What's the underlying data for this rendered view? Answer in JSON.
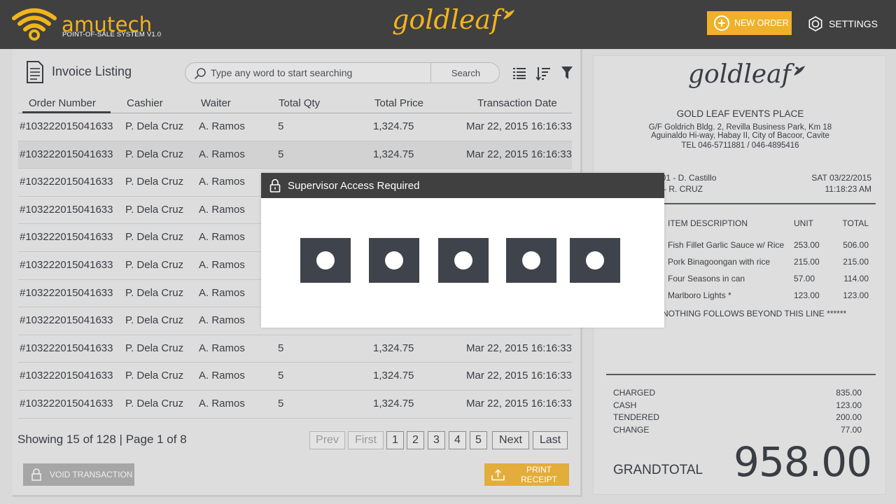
{
  "header": {
    "brand_name": "amutech",
    "brand_sub": "POINT-OF-SALE SYSTEM V1.0",
    "logo_text": "goldleaf",
    "new_order_label": "NEW ORDER",
    "settings_label": "SETTINGS",
    "accent": "#f2b41c"
  },
  "invoice": {
    "title": "Invoice Listing",
    "search_placeholder": "Type any word to start searching",
    "search_button": "Search",
    "columns": [
      "Order Number",
      "Cashier",
      "Waiter",
      "Total Qty",
      "Total Price",
      "Transaction Date"
    ],
    "rows": [
      {
        "order": "#103222015041633",
        "cashier": "P. Dela Cruz",
        "waiter": "A. Ramos",
        "qty": "5",
        "price": "1,324.75",
        "date": "Mar 22, 2015 16:16:33"
      },
      {
        "order": "#103222015041633",
        "cashier": "P. Dela Cruz",
        "waiter": "A. Ramos",
        "qty": "5",
        "price": "1,324.75",
        "date": "Mar 22, 2015 16:16:33"
      },
      {
        "order": "#103222015041633",
        "cashier": "P. Dela Cruz",
        "waiter": "A. Ramos",
        "qty": "",
        "price": "",
        "date": ""
      },
      {
        "order": "#103222015041633",
        "cashier": "P. Dela Cruz",
        "waiter": "A. Ramos",
        "qty": "",
        "price": "",
        "date": ""
      },
      {
        "order": "#103222015041633",
        "cashier": "P. Dela Cruz",
        "waiter": "A. Ramos",
        "qty": "",
        "price": "",
        "date": ""
      },
      {
        "order": "#103222015041633",
        "cashier": "P. Dela Cruz",
        "waiter": "A. Ramos",
        "qty": "",
        "price": "",
        "date": ""
      },
      {
        "order": "#103222015041633",
        "cashier": "P. Dela Cruz",
        "waiter": "A. Ramos",
        "qty": "",
        "price": "",
        "date": ""
      },
      {
        "order": "#103222015041633",
        "cashier": "P. Dela Cruz",
        "waiter": "A. Ramos",
        "qty": "",
        "price": "",
        "date": ""
      },
      {
        "order": "#103222015041633",
        "cashier": "P. Dela Cruz",
        "waiter": "A. Ramos",
        "qty": "5",
        "price": "1,324.75",
        "date": "Mar 22, 2015 16:16:33"
      },
      {
        "order": "#103222015041633",
        "cashier": "P. Dela Cruz",
        "waiter": "A. Ramos",
        "qty": "5",
        "price": "1,324.75",
        "date": "Mar 22, 2015 16:16:33"
      },
      {
        "order": "#103222015041633",
        "cashier": "P. Dela Cruz",
        "waiter": "A. Ramos",
        "qty": "5",
        "price": "1,324.75",
        "date": "Mar 22, 2015 16:16:33"
      }
    ],
    "showing": "Showing 15 of 128 | Page 1 of 8",
    "pagination": {
      "prev": "Prev",
      "first": "First",
      "pages": [
        "1",
        "2",
        "3",
        "4",
        "5"
      ],
      "next": "Next",
      "last": "Last"
    },
    "void_label": "VOID TRANSACTION",
    "print_label": "PRINT RECEIPT"
  },
  "receipt": {
    "logo_text": "goldleaf",
    "business_name": "GOLD LEAF EVENTS PLACE",
    "address_1": "G/F Goldrich Bldg. 2, Revilla Business Park, Km 18",
    "address_2": "Aguinaldo Hi-way, Habay II, City of Bacoor, Cavite",
    "tel": "TEL 046-5711881 / 046-4895416",
    "staff_1": "001 - D. Castillo",
    "staff_2": "3 - R. CRUZ",
    "date": "SAT 03/22/2015",
    "time": "11:18:23 AM",
    "col_desc": "ITEM DESCRIPTION",
    "col_unit": "UNIT",
    "col_total": "TOTAL",
    "items": [
      {
        "desc": "Fish Fillet Garlic Sauce w/ Rice",
        "unit": "253.00",
        "total": "506.00"
      },
      {
        "desc": "Pork Binagoongan with rice",
        "unit": "215.00",
        "total": "215.00"
      },
      {
        "desc": "Four Seasons in can",
        "unit": "57.00",
        "total": "114.00"
      },
      {
        "desc": "Marlboro Lights *",
        "unit": "123.00",
        "total": "123.00"
      }
    ],
    "footer_note": "NOTHING FOLLOWS BEYOND THIS LINE ******",
    "summary": [
      {
        "label": "CHARGED",
        "value": "835.00"
      },
      {
        "label": "CASH",
        "value": "123.00"
      },
      {
        "label": "TENDERED",
        "value": "200.00"
      },
      {
        "label": "CHANGE",
        "value": "77.00"
      }
    ],
    "grand_label": "GRANDTOTAL",
    "grand_value": "958.00"
  },
  "modal": {
    "title": "Supervisor Access Required",
    "pin_digits_entered": 5
  }
}
